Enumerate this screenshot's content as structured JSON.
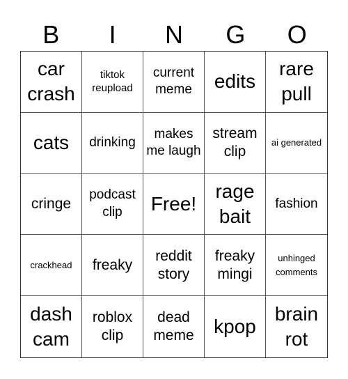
{
  "header": [
    "B",
    "I",
    "N",
    "G",
    "O"
  ],
  "cells": [
    "car crash",
    "tiktok reupload",
    "current meme",
    "edits",
    "rare pull",
    "cats",
    "drinking",
    "makes me laugh",
    "stream clip",
    "ai generated",
    "cringe",
    "podcast clip",
    "Free!",
    "rage bait",
    "fashion",
    "crackhead",
    "freaky",
    "reddit story",
    "freaky mingi",
    "unhinged comments",
    "dash cam",
    "roblox clip",
    "dead meme",
    "kpop",
    "brain rot"
  ]
}
